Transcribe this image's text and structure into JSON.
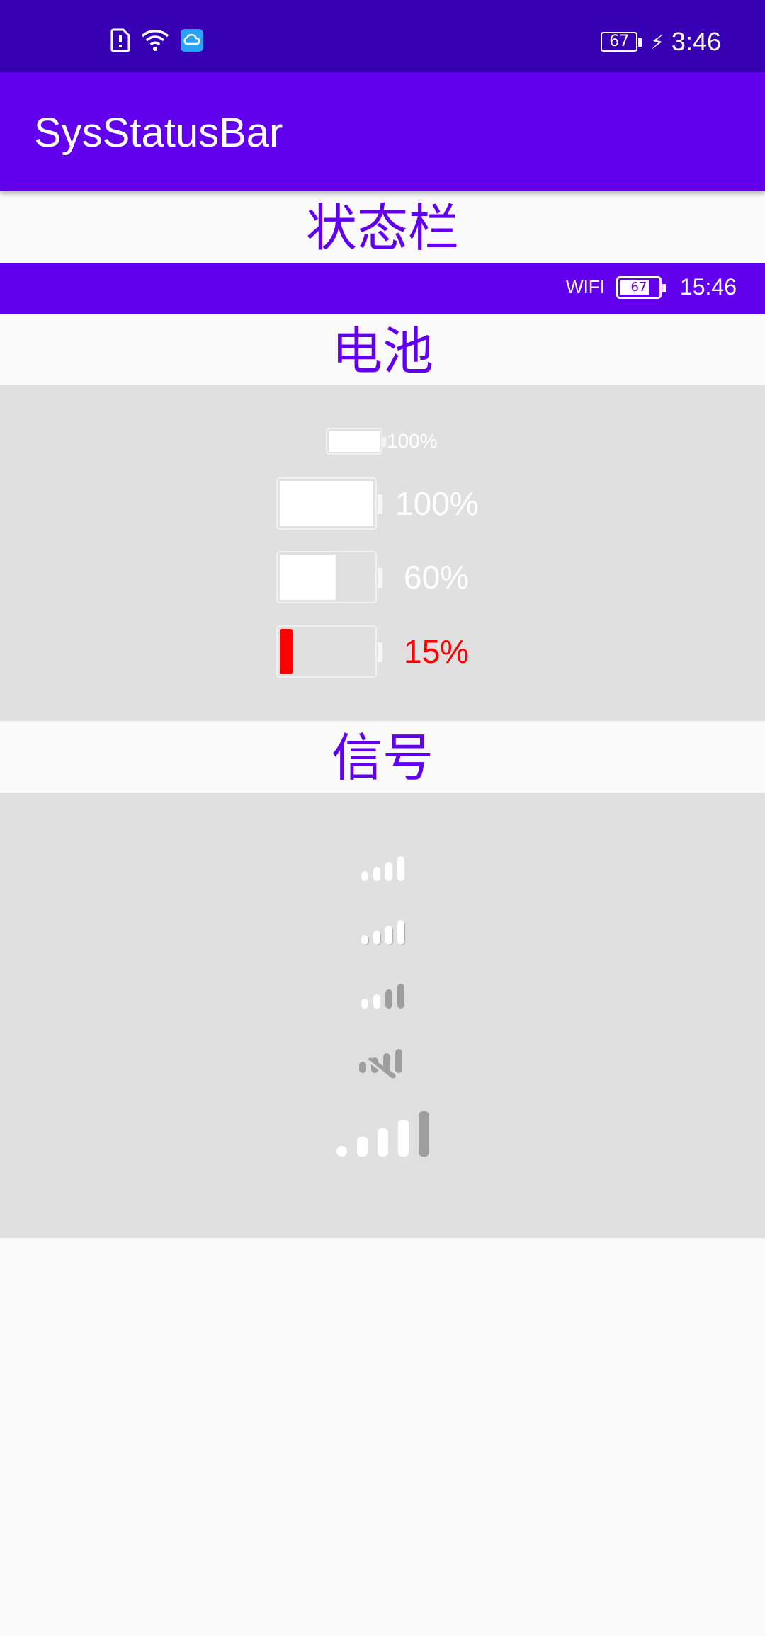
{
  "status_bar": {
    "time": "3:46",
    "battery": "67",
    "icons": [
      "sim-alert-icon",
      "wifi-icon",
      "cloud-app-icon",
      "battery-icon",
      "charging-bolt-icon"
    ]
  },
  "app_bar": {
    "title": "SysStatusBar"
  },
  "sections": {
    "statusbar_title": "状态栏",
    "battery_title": "电池",
    "signal_title": "信号"
  },
  "custom_status_bar": {
    "wifi_label": "WIFI",
    "battery_level": "67",
    "time": "15:46"
  },
  "battery_samples": [
    {
      "label": "100%",
      "level": 1.0,
      "color": "#ffffff"
    },
    {
      "label": "100%",
      "level": 1.0,
      "color": "#ffffff"
    },
    {
      "label": "60%",
      "level": 0.6,
      "color": "#ffffff"
    },
    {
      "label": "15%",
      "level": 0.15,
      "color": "#ff0000"
    }
  ],
  "signal_samples": [
    {
      "active_bars": 4
    },
    {
      "active_bars": 4
    },
    {
      "active_bars": 2
    },
    {
      "active_bars": 0,
      "no_service": true
    },
    {
      "active_bars": 4,
      "total_bars": 5
    }
  ],
  "colors": {
    "primary": "#6200ee",
    "primary_dark": "#3700b3",
    "panel": "#e0e0e0",
    "low_battery": "#ff0000",
    "inactive_bar": "#9e9e9e"
  }
}
